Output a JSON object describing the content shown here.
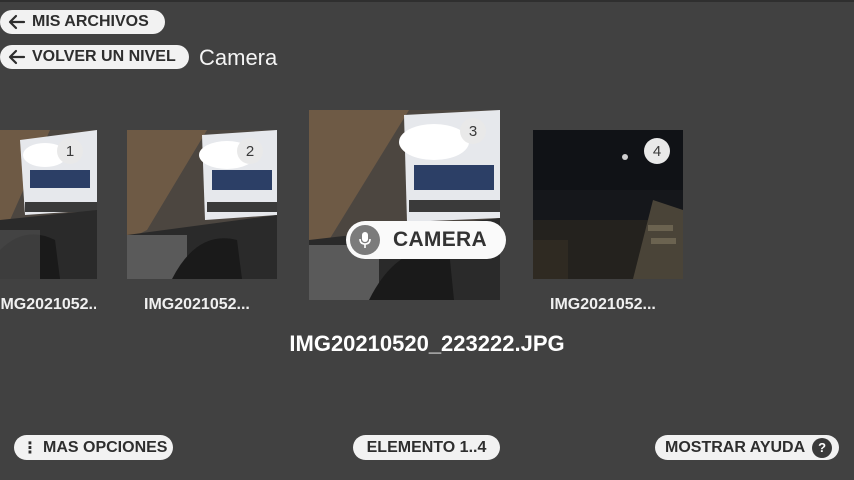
{
  "nav": {
    "files_label": "MIS ARCHIVOS",
    "back_label": "VOLVER UN NIVEL",
    "folder_title": "Camera"
  },
  "gallery": {
    "items": [
      {
        "number": "1",
        "caption": "IMG2021052..."
      },
      {
        "number": "2",
        "caption": "IMG2021052..."
      },
      {
        "number": "3",
        "caption": ""
      },
      {
        "number": "4",
        "caption": "IMG2021052..."
      }
    ],
    "voice_label": "CAMERA",
    "selected_filename": "IMG20210520_223222.JPG"
  },
  "footer": {
    "more_label": "MAS OPCIONES",
    "element_label": "ELEMENTO 1..4",
    "help_label": "MOSTRAR AYUDA",
    "help_icon_text": "?"
  },
  "icons": {
    "arrow": "arrow-left-icon",
    "mic": "microphone-icon",
    "more": "more-vertical-icon",
    "help": "question-icon"
  },
  "colors": {
    "background": "#414141",
    "pill": "#f2f2f2",
    "pill_text": "#2e2e2e"
  }
}
